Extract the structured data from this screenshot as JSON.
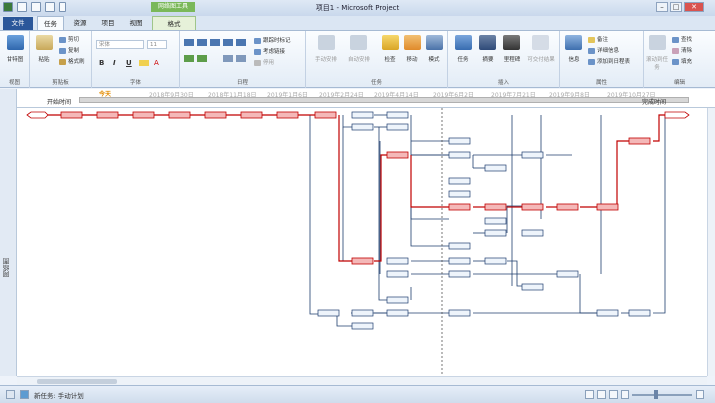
{
  "window": {
    "title": "项目1 - Microsoft Project",
    "context_tab_group": "网络图工具"
  },
  "tabs": {
    "file": "文件",
    "task": "任务",
    "resource": "资源",
    "project": "项目",
    "view": "视图",
    "format": "格式"
  },
  "ribbon": {
    "view": {
      "gantt": "甘特图",
      "group": "视图"
    },
    "clipboard": {
      "paste": "粘贴",
      "cut": "剪切",
      "copy": "复制",
      "format_painter": "格式刷",
      "group": "剪贴板"
    },
    "font": {
      "font_name": "宋体",
      "font_size": "11",
      "bold": "B",
      "italic": "I",
      "underline": "U",
      "group": "字体"
    },
    "schedule": {
      "follow_mark": "跟踪时标记",
      "respect_links": "考虑链接",
      "inactivate": "停用",
      "group": "日程"
    },
    "tasks": {
      "manual": "手动安排",
      "auto": "自动安排",
      "inspect": "检查",
      "move": "移动",
      "mode": "模式",
      "group": "任务"
    },
    "insert": {
      "task": "任务",
      "summary": "摘要",
      "milestone": "里程碑",
      "deliverable": "可交付结果",
      "group": "插入"
    },
    "properties": {
      "info": "信息",
      "notes": "备注",
      "details": "详细信息",
      "add_timeline": "添加到日程表",
      "group": "属性"
    },
    "editing": {
      "scroll_to_task": "滚动到任务",
      "find": "查找",
      "clear": "清除",
      "fill": "填充",
      "group": "编辑"
    }
  },
  "timeline": {
    "side_label": "日程表",
    "today": "今天",
    "start": "开始时间",
    "finish": "完成时间",
    "dates": [
      "2018年9月30日",
      "2018年11月18日",
      "2019年1月6日",
      "2019年2月24日",
      "2019年4月14日",
      "2019年6月2日",
      "2019年7月21日",
      "2019年9月8日",
      "2019年10月27日"
    ]
  },
  "sidebar": {
    "label": "网络图"
  },
  "status": {
    "text": "新任务: 手动计划"
  },
  "colors": {
    "critical": "#c00000",
    "critical_fill": "#f4b8b8",
    "normal": "#1f3e6e",
    "normal_fill": "#dde9f7",
    "today_line": "#555555"
  }
}
